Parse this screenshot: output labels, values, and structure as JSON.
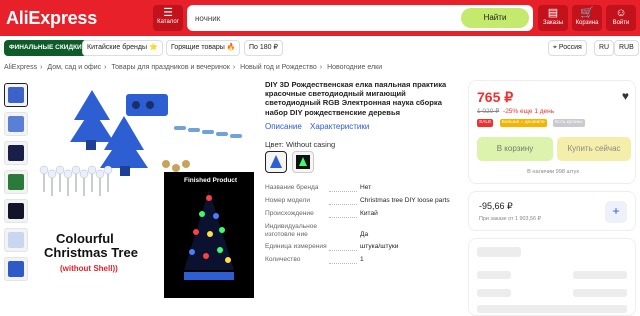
{
  "header": {
    "logo": "AliExpress",
    "catalog_label": "Каталог",
    "search_value": "ночник",
    "search_button": "Найти",
    "orders_label": "Заказы",
    "cart_label": "Корзина",
    "login_label": "Войти",
    "accent_color": "#e8202a",
    "search_button_color": "#c3ea6d"
  },
  "subnav": {
    "promo": "ФИНАЛЬНЫЕ СКИДКИ",
    "items": [
      "Китайские бренды ⭐",
      "Горящие товары 🔥",
      "По 180 ₽"
    ],
    "region": "Россия",
    "language": "RU",
    "currency": "RUB"
  },
  "breadcrumb": [
    "AliExpress",
    "Дом, сад и офис",
    "Товары для праздников и вечеринок",
    "Новый год и Рождество",
    "Новогодние елки"
  ],
  "gallery": {
    "banner_title_line1": "Colourful",
    "banner_title_line2": "Christmas Tree",
    "banner_subtitle": "(without Shell))",
    "finished_label": "Finished Product"
  },
  "product": {
    "title": "DIY 3D Рождественская елка паяльная практика красочные светодиодный мигающий светодиодный RGB Электронная наука сборка набор DIY рождественские деревья",
    "tabs": [
      "Описание",
      "Характеристики"
    ],
    "color_label": "Цвет: Without casing",
    "specs": [
      {
        "key": "Название бренда",
        "value": "Нет"
      },
      {
        "key": "Номер модели",
        "value": "Christmas tree DIY loose parts"
      },
      {
        "key": "Происхождение",
        "value": "Китай"
      },
      {
        "key": "Индивидуальное изготовле ние",
        "value": "Да"
      },
      {
        "key": "Единица измерения",
        "value": "штука/штуки"
      },
      {
        "key": "Количество",
        "value": "1"
      }
    ]
  },
  "purchase": {
    "price": "765 ₽",
    "old_price": "1 020 ₽",
    "discount": "-25% еще 1 день",
    "badges": [
      "SALE",
      "Больше = дешевле",
      "Есть купоны"
    ],
    "cart_button": "В корзину",
    "buy_now_button": "Купить сейчас",
    "stock": "В наличии 998 штук",
    "price_color": "#f0302e"
  },
  "coupon": {
    "amount": "-95,66 ₽",
    "note": "При заказе от 1 903,56 ₽",
    "add": "+"
  }
}
